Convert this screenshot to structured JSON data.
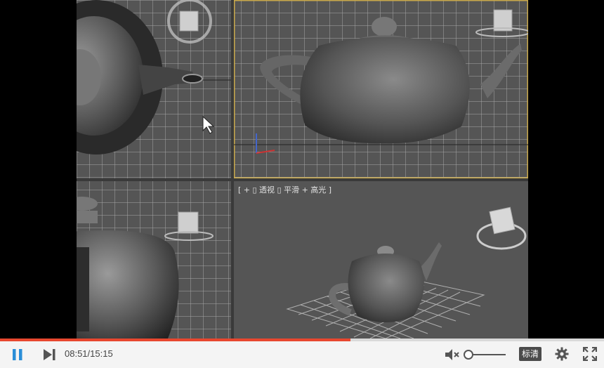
{
  "viewport": {
    "label_perspective": "[ + ▯ 透视 ▯ 平滑 + 高光 ]"
  },
  "player": {
    "current_time": "08:51",
    "separator": "/",
    "total_time": "15:15",
    "progress": 0.58,
    "volume": 0.1,
    "muted": true,
    "quality_label": "标清",
    "icons": {
      "play_pause": "pause-icon",
      "next": "next-icon",
      "volume": "volume-muted-icon",
      "settings": "gear-icon",
      "fullscreen": "fullscreen-icon"
    },
    "colors": {
      "accent": "#2a8ed8",
      "progress": "#e8472f",
      "bar_bg": "#f4f4f4"
    }
  }
}
